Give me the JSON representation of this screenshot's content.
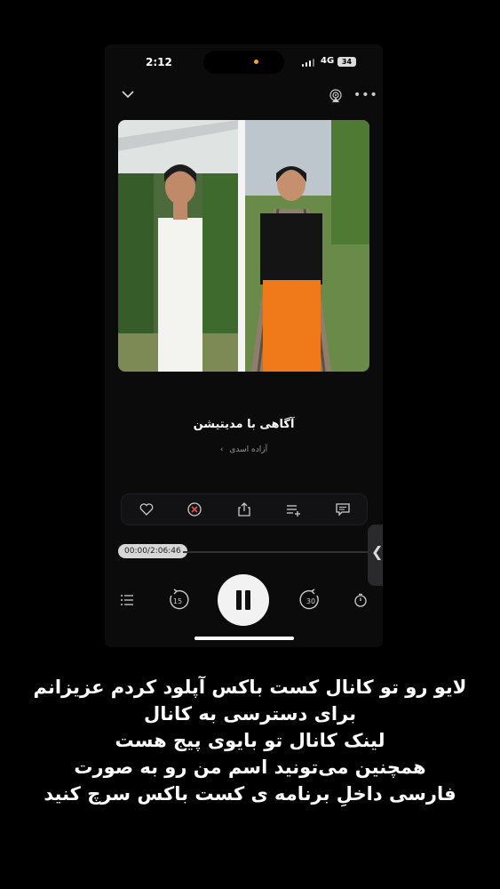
{
  "status_bar": {
    "time": "2:12",
    "network": "4G",
    "battery": "34"
  },
  "track": {
    "title": "آگاهی با مدیتیشن",
    "artist": "آزاده اسدی"
  },
  "player": {
    "elapsed_total": "00:00/2:06:46",
    "skip_back": "15",
    "skip_forward": "30",
    "progress": 0
  },
  "caption": {
    "line1": "لایو رو تو کانال کست باکس آپلود کردم عزیزانم",
    "line2": "برای دسترسی به کانال",
    "line3": "لینک کانال تو بایوی پیج هست",
    "line4": "همچنین می‌تونید اسم من رو به صورت",
    "line5": "فارسی داخلِ برنامه ی کست باکس سرچ کنید"
  },
  "icons": {
    "top": [
      "chevron-down-icon",
      "airplay-icon",
      "more-icon"
    ],
    "actions": [
      "heart-icon",
      "close-circle-icon",
      "share-icon",
      "add-to-playlist-icon",
      "comment-icon"
    ],
    "controls": [
      "queue-icon",
      "rewind-15-icon",
      "pause-icon",
      "forward-30-icon",
      "timer-icon"
    ]
  },
  "colors": {
    "background": "#000000",
    "phone": "#0b0b0c",
    "accent_orange": "#f07a1a",
    "close_red": "#e0524f"
  }
}
